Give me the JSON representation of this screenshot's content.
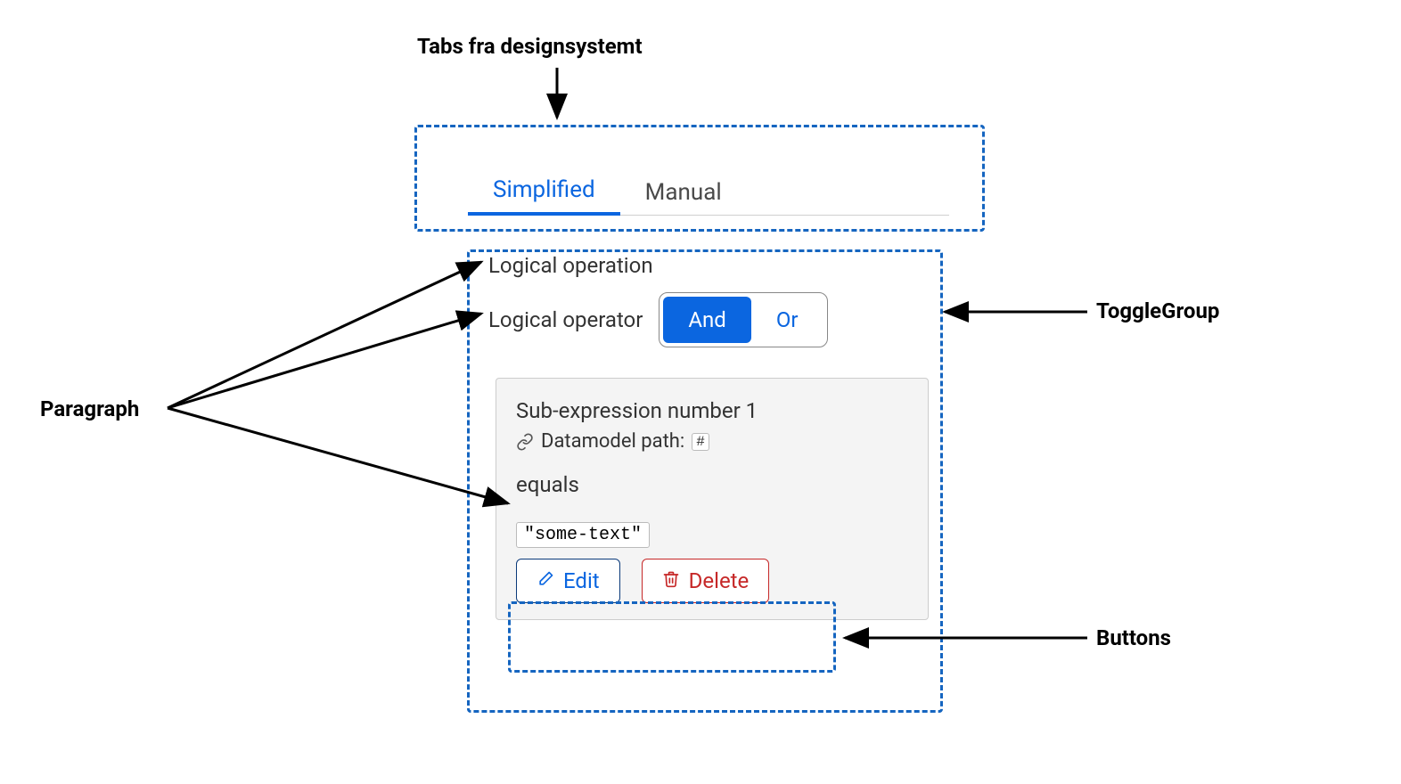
{
  "annotations": {
    "tabs_label": "Tabs fra designsystemt",
    "paragraph_label": "Paragraph",
    "togglegroup_label": "ToggleGroup",
    "buttons_label": "Buttons"
  },
  "tabs": {
    "items": [
      {
        "label": "Simplified",
        "active": true
      },
      {
        "label": "Manual",
        "active": false
      }
    ]
  },
  "logical": {
    "section_title": "Logical operation",
    "operator_label": "Logical operator",
    "options": [
      {
        "label": "And",
        "selected": true
      },
      {
        "label": "Or",
        "selected": false
      }
    ]
  },
  "card": {
    "title": "Sub-expression number 1",
    "datamodel_label": "Datamodel path:",
    "datamodel_value": "#",
    "operator": "equals",
    "value_literal": "\"some-text\"",
    "buttons": {
      "edit": "Edit",
      "delete": "Delete"
    }
  },
  "colors": {
    "accent": "#0b66e0",
    "danger": "#c62828",
    "dash": "#1565c0"
  }
}
